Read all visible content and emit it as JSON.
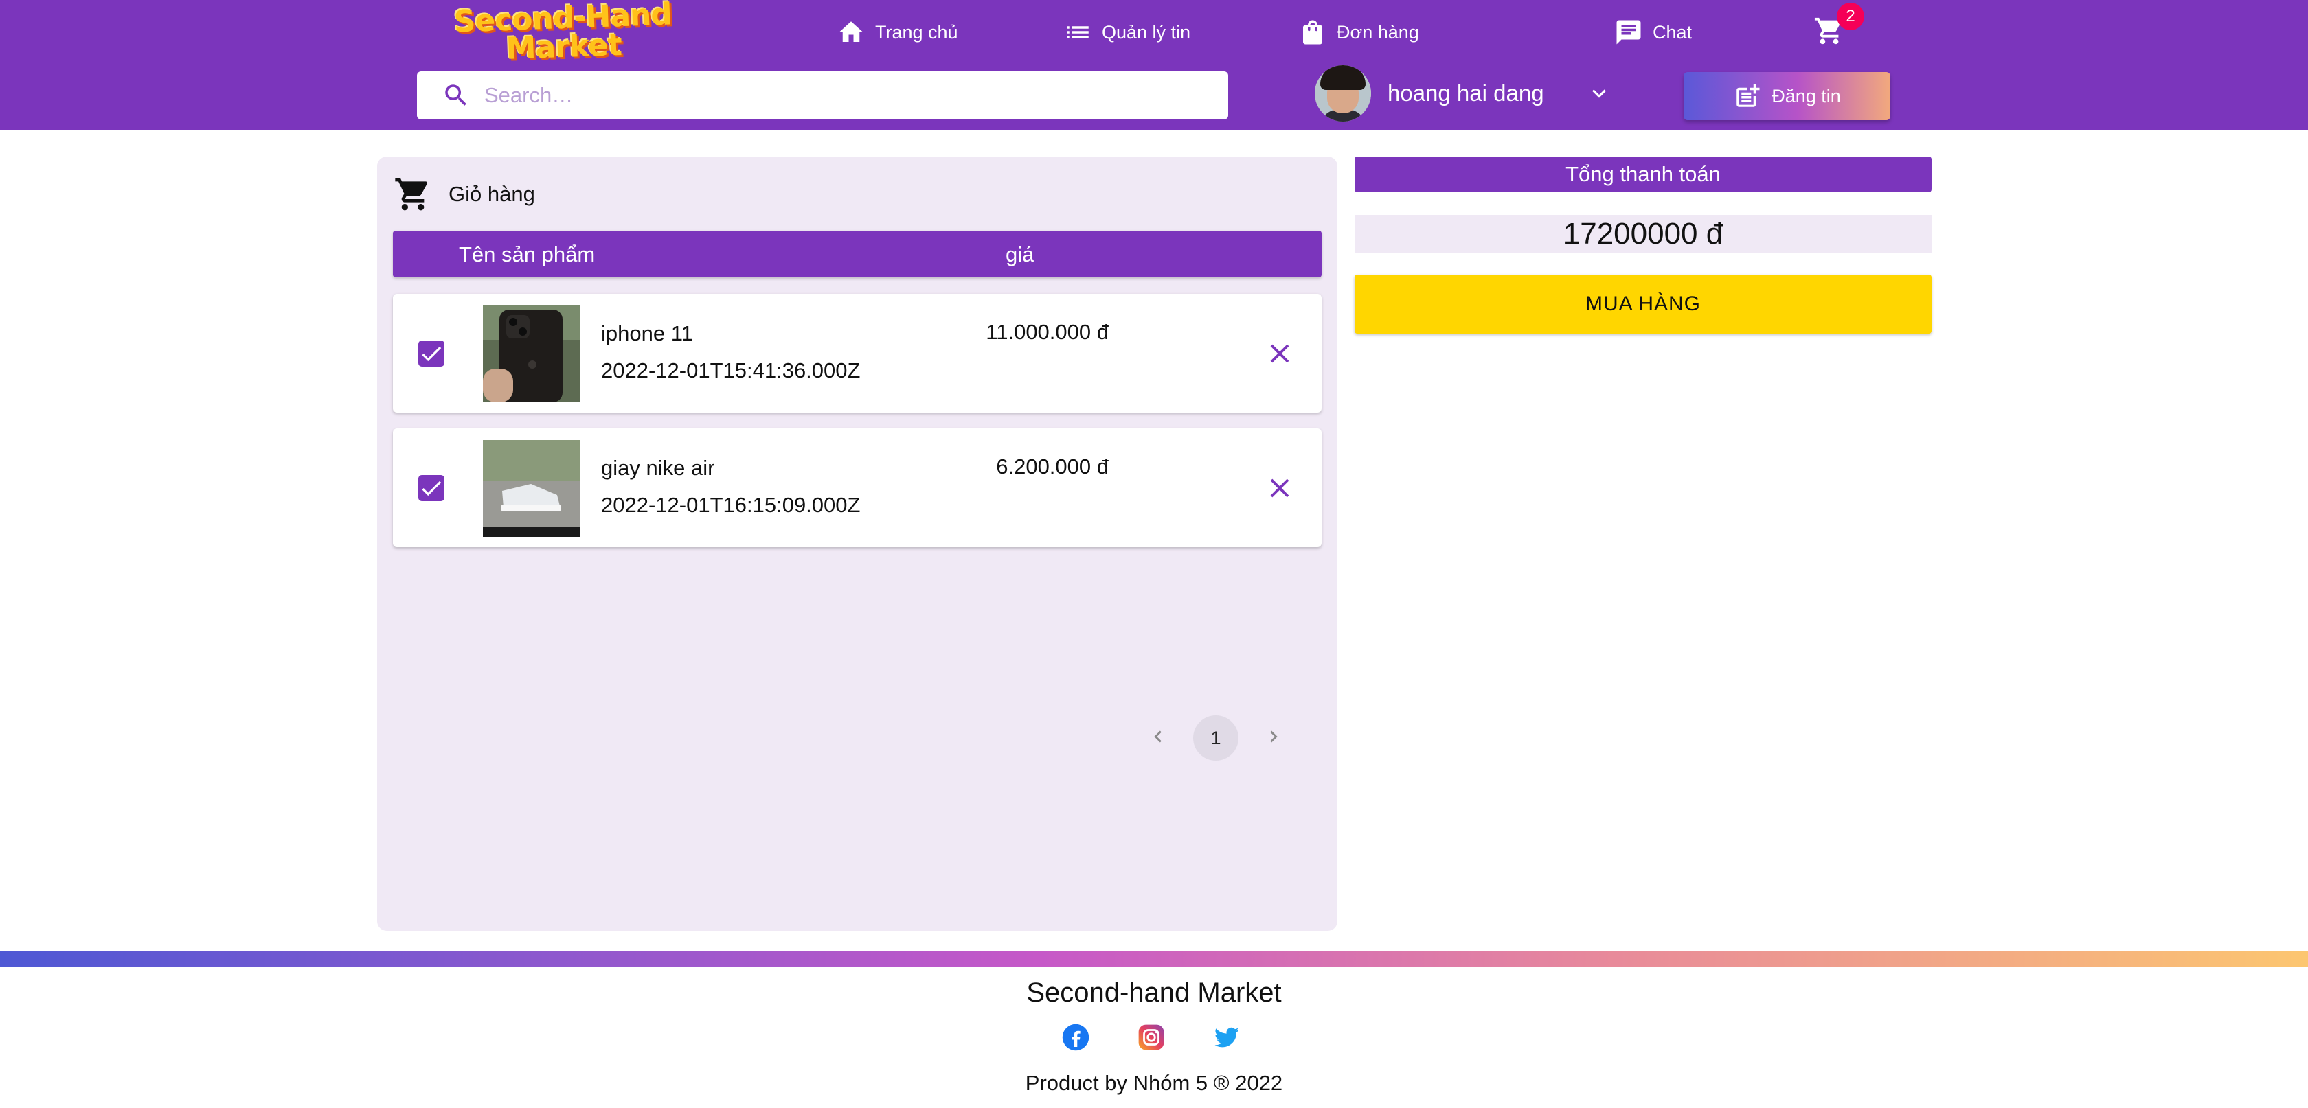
{
  "brand": {
    "logo_line1": "Second-Hand",
    "logo_line2": "Market"
  },
  "nav": {
    "home": "Trang chủ",
    "manage": "Quản lý tin",
    "orders": "Đơn hàng",
    "chat": "Chat",
    "cart_count": "2"
  },
  "search": {
    "placeholder": "Search…"
  },
  "user": {
    "name": "hoang hai dang"
  },
  "post_button": {
    "label": "Đăng tin"
  },
  "cart": {
    "title": "Giỏ hàng",
    "columns": {
      "name": "Tên sản phẩm",
      "price": "giá"
    },
    "items": [
      {
        "name": "iphone 11",
        "date": "2022-12-01T15:41:36.000Z",
        "price": "11.000.000 đ",
        "checked": true
      },
      {
        "name": "giay nike air",
        "date": "2022-12-01T16:15:09.000Z",
        "price": "6.200.000 đ",
        "checked": true
      }
    ],
    "pagination": {
      "current": "1"
    }
  },
  "summary": {
    "title": "Tổng thanh toán",
    "total": "17200000 đ",
    "buy_label": "MUA HÀNG"
  },
  "footer": {
    "title": "Second-hand Market",
    "credit": "Product by Nhóm 5 ® 2022",
    "socials": [
      "facebook-icon",
      "instagram-icon",
      "twitter-icon"
    ]
  },
  "colors": {
    "primary": "#7b35bc",
    "accent": "#ffd600",
    "badge": "#f50057",
    "panel": "#f0e9f5"
  }
}
